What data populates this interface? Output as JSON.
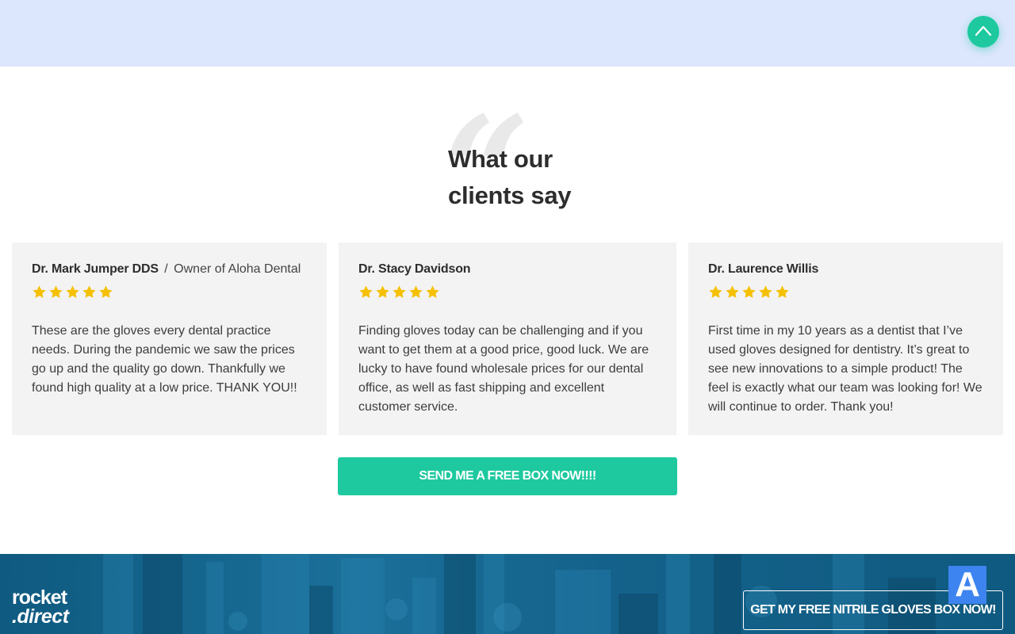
{
  "scroll_top": {
    "icon": "chevron-up-icon"
  },
  "testimonials": {
    "heading_line1": "What our",
    "heading_line2": "clients say",
    "quote_glyph": "“",
    "cards": [
      {
        "name": "Dr. Mark Jumper DDS",
        "separator": "/",
        "role": "Owner of Aloha Dental",
        "rating": 5,
        "text": "These are the gloves every dental practice needs. During the pandemic we saw the prices go up and the quality go down. Thankfully we found high quality at a low price. THANK YOU!!"
      },
      {
        "name": "Dr. Stacy Davidson",
        "rating": 5,
        "text": "Finding gloves today can be challenging and if you want to get them at a good price, good luck. We are lucky to have found wholesale prices for our dental office, as well as fast shipping and excellent customer service."
      },
      {
        "name": "Dr. Laurence Willis",
        "rating": 5,
        "text": "First time in my 10 years as a dentist that I’ve used gloves designed for dentistry. It’s great to see new innovations to a simple product! The feel is exactly what our team was looking for! We will continue to order. Thank you!"
      }
    ],
    "cta_label": "SEND ME A FREE BOX NOW!!!!"
  },
  "footer": {
    "logo_line1": "rocket",
    "logo_line2": ".direct",
    "cta_label": "GET MY FREE NITRILE GLOVES BOX NOW!",
    "badge_letter": "A"
  },
  "colors": {
    "top_band": "#dce6fd",
    "accent": "#1ec99f",
    "star": "#f5c000",
    "card_bg": "#f3f3f3",
    "footer_bg": "#14628b",
    "badge": "#3d84f0"
  }
}
